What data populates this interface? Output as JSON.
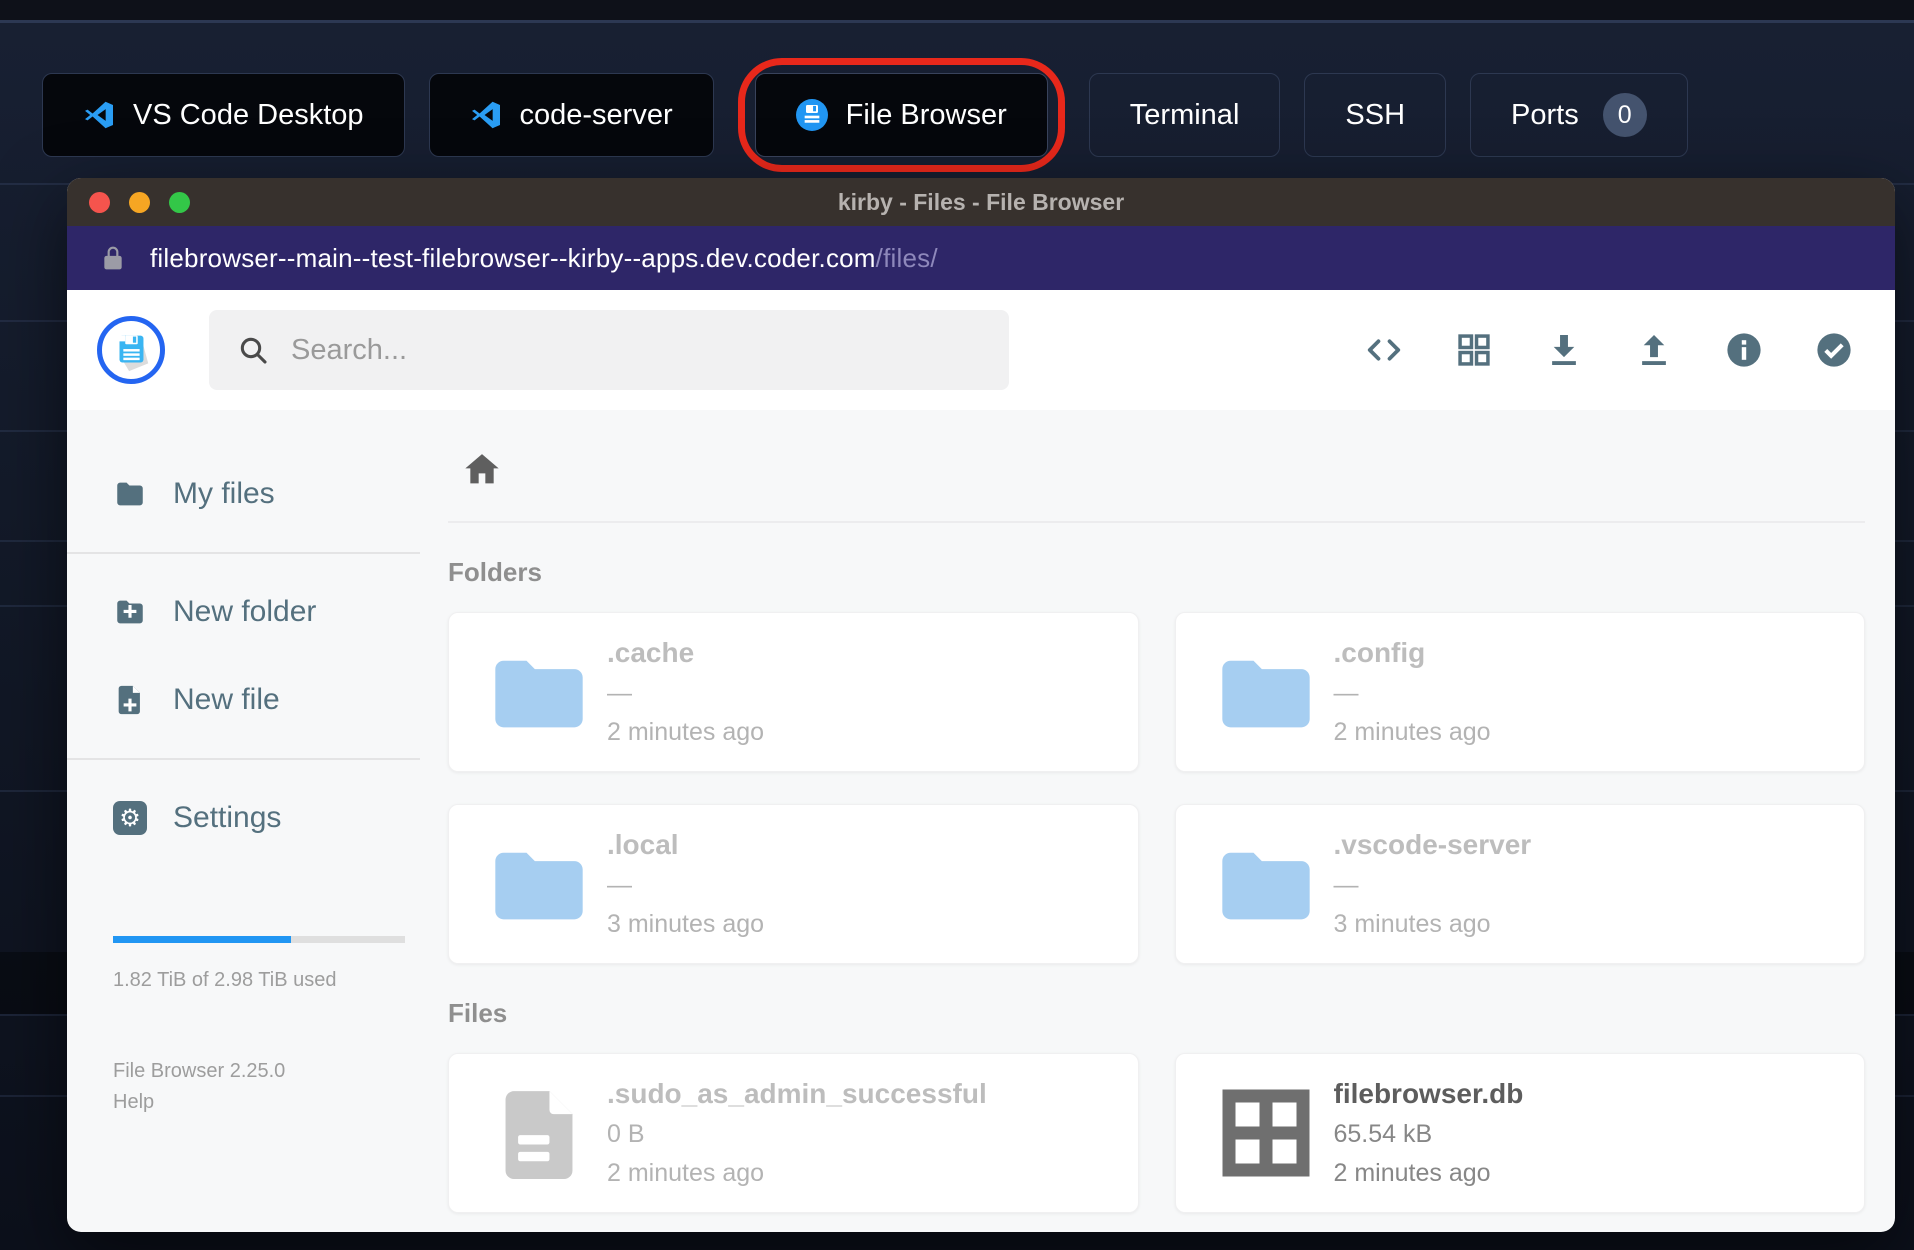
{
  "toolbar": {
    "buttons": [
      {
        "label": "VS Code Desktop",
        "icon": "vscode-icon"
      },
      {
        "label": "code-server",
        "icon": "vscode-icon"
      },
      {
        "label": "File Browser",
        "icon": "filebrowser-favicon",
        "annotated": true
      },
      {
        "label": "Terminal"
      },
      {
        "label": "SSH"
      },
      {
        "label": "Ports",
        "badge": "0"
      }
    ]
  },
  "window": {
    "title": "kirby - Files - File Browser",
    "url": {
      "domain": "filebrowser--main--test-filebrowser--kirby--apps.dev.coder.com",
      "path": "/files/"
    }
  },
  "app": {
    "search": {
      "placeholder": "Search..."
    },
    "header_icons": [
      "code-icon",
      "grid-view-icon",
      "download-icon",
      "upload-icon",
      "info-icon",
      "check-circle-icon"
    ],
    "sidebar": {
      "items": [
        {
          "label": "My files",
          "icon": "folder-icon"
        },
        {
          "label": "New folder",
          "icon": "folder-plus-icon"
        },
        {
          "label": "New file",
          "icon": "file-plus-icon"
        },
        {
          "label": "Settings",
          "icon": "gear-icon"
        }
      ],
      "usage": {
        "percent": 61,
        "text": "1.82 TiB of 2.98 TiB used"
      },
      "version": "File Browser 2.25.0",
      "help_label": "Help"
    },
    "main": {
      "folders_label": "Folders",
      "files_label": "Files",
      "folders": [
        {
          "name": ".cache",
          "size": "—",
          "modified": "2 minutes ago",
          "hidden": true
        },
        {
          "name": ".config",
          "size": "—",
          "modified": "2 minutes ago",
          "hidden": true
        },
        {
          "name": ".local",
          "size": "—",
          "modified": "3 minutes ago",
          "hidden": true
        },
        {
          "name": ".vscode-server",
          "size": "—",
          "modified": "3 minutes ago",
          "hidden": true
        }
      ],
      "files": [
        {
          "name": ".sudo_as_admin_successful",
          "size": "0 B",
          "modified": "2 minutes ago",
          "hidden": true,
          "icon": "file-icon"
        },
        {
          "name": "filebrowser.db",
          "size": "65.54 kB",
          "modified": "2 minutes ago",
          "hidden": false,
          "icon": "database-grid-icon"
        }
      ]
    }
  },
  "colors": {
    "annotation_red": "#e8281b",
    "progress_blue": "#2196f3",
    "folder_blue": "#a6cef1",
    "slate_icon": "#54707e",
    "urlbar_indigo": "#2e2668",
    "titlebar_gray": "#37312d"
  }
}
